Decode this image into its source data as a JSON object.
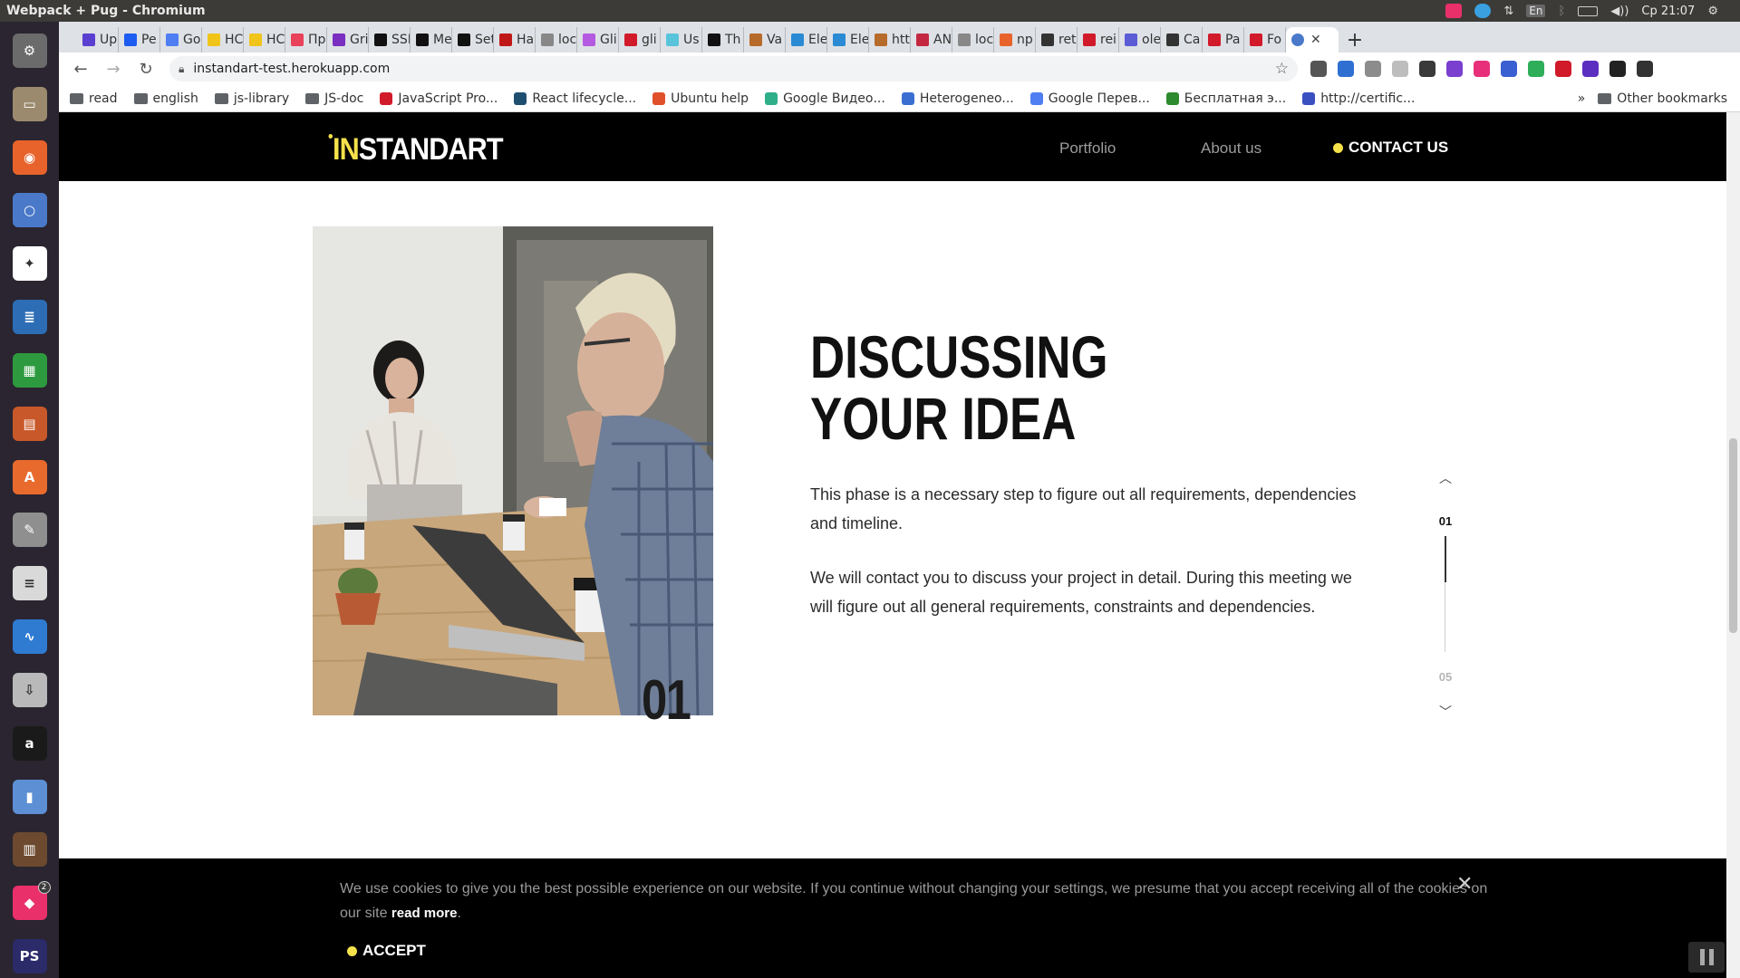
{
  "os": {
    "window_title": "Webpack + Pug - Chromium",
    "lang": "En",
    "clock": "Ср 21:07"
  },
  "launcher": {
    "items": [
      {
        "name": "settings-icon",
        "color": "#6b6b6b",
        "glyph": "⚙"
      },
      {
        "name": "files-icon",
        "color": "#9b8a6e",
        "glyph": "▭"
      },
      {
        "name": "firefox-icon",
        "color": "#e8632b",
        "glyph": "◉"
      },
      {
        "name": "chromium-icon",
        "color": "#4a79c9",
        "glyph": "○"
      },
      {
        "name": "slack-icon",
        "color": "#ffffff",
        "glyph": "✦"
      },
      {
        "name": "writer-icon",
        "color": "#2d6db5",
        "glyph": "≣"
      },
      {
        "name": "calc-icon",
        "color": "#2e9a3f",
        "glyph": "▦"
      },
      {
        "name": "impress-icon",
        "color": "#c8582a",
        "glyph": "▤"
      },
      {
        "name": "software-center-icon",
        "color": "#e86b2d",
        "glyph": "A"
      },
      {
        "name": "system-tools-icon",
        "color": "#8f8f8f",
        "glyph": "✎"
      },
      {
        "name": "text-editor-icon",
        "color": "#d9d9d9",
        "glyph": "≡"
      },
      {
        "name": "system-monitor-icon",
        "color": "#2f7bd1",
        "glyph": "∿"
      },
      {
        "name": "installer-icon",
        "color": "#b9b9b9",
        "glyph": "⇩"
      },
      {
        "name": "amazon-icon",
        "color": "#1a1a1a",
        "glyph": "a"
      },
      {
        "name": "thermometer-icon",
        "color": "#5d8fd4",
        "glyph": "▮"
      },
      {
        "name": "library-icon",
        "color": "#6d4a2f",
        "glyph": "▥"
      },
      {
        "name": "jetbrains-icon",
        "color": "#e9306b",
        "glyph": "◆",
        "badge": "2"
      },
      {
        "name": "phpstorm-icon",
        "color": "#2b2b6a",
        "glyph": "PS"
      }
    ]
  },
  "browser": {
    "tabs": [
      {
        "label": "Up",
        "color": "#5b3fd1"
      },
      {
        "label": "Pe",
        "color": "#1d5cf0"
      },
      {
        "label": "Go",
        "color": "#4f7ef2"
      },
      {
        "label": "HC",
        "color": "#f0c419"
      },
      {
        "label": "HC",
        "color": "#f0c419"
      },
      {
        "label": "Пр",
        "color": "#e8435a"
      },
      {
        "label": "Gri",
        "color": "#7a2fc0"
      },
      {
        "label": "SSI",
        "color": "#111111"
      },
      {
        "label": "Me",
        "color": "#111111"
      },
      {
        "label": "Set",
        "color": "#111111"
      },
      {
        "label": "Ha",
        "color": "#c01818"
      },
      {
        "label": "loc",
        "color": "#888888"
      },
      {
        "label": "Gli",
        "color": "#b45ae0"
      },
      {
        "label": "gli",
        "color": "#d11a2a"
      },
      {
        "label": "Us",
        "color": "#58c4dc"
      },
      {
        "label": "Th",
        "color": "#111111"
      },
      {
        "label": "Va",
        "color": "#b66b2a"
      },
      {
        "label": "Ele",
        "color": "#2a8ad4"
      },
      {
        "label": "Ele",
        "color": "#2a8ad4"
      },
      {
        "label": "htt",
        "color": "#b66b2a"
      },
      {
        "label": "AN",
        "color": "#c42840"
      },
      {
        "label": "loc",
        "color": "#888888"
      },
      {
        "label": "np",
        "color": "#e8632b"
      },
      {
        "label": "ret",
        "color": "#333333"
      },
      {
        "label": "rei",
        "color": "#d11a2a"
      },
      {
        "label": "ole",
        "color": "#5b5bd6"
      },
      {
        "label": "Ca",
        "color": "#333333"
      },
      {
        "label": "Pa",
        "color": "#d11a2a"
      },
      {
        "label": "Fo",
        "color": "#d11a2a"
      }
    ],
    "active_tab_color": "#4a79c9",
    "url": "instandart-test.herokuapp.com",
    "extensions": [
      "#555555",
      "#2f6fd1",
      "#8c8c8c",
      "#bdbdbd",
      "#3a3a3a",
      "#7b3fd0",
      "#e8307a",
      "#3a5fd1",
      "#2fae5a",
      "#d11a2a",
      "#5b2fc0",
      "#222222",
      "#333333"
    ],
    "bookmarks": [
      {
        "label": "read",
        "type": "folder"
      },
      {
        "label": "english",
        "type": "folder"
      },
      {
        "label": "js-library",
        "type": "folder"
      },
      {
        "label": "JS-doc",
        "type": "folder"
      },
      {
        "label": "JavaScript Pro...",
        "type": "site",
        "color": "#d11a2a"
      },
      {
        "label": "React lifecycle...",
        "type": "site",
        "color": "#1f4f6f"
      },
      {
        "label": "Ubuntu help",
        "type": "site",
        "color": "#e0502a"
      },
      {
        "label": "Google Видео...",
        "type": "site",
        "color": "#2fae8a"
      },
      {
        "label": "Heterogeneo...",
        "type": "site",
        "color": "#3a6fd1"
      },
      {
        "label": "Google Перев...",
        "type": "site",
        "color": "#4f7ef2"
      },
      {
        "label": "Бесплатная э...",
        "type": "site",
        "color": "#2e8a2e"
      },
      {
        "label": "http://certific...",
        "type": "site",
        "color": "#3a4fc0"
      }
    ],
    "bookmarks_overflow": "»",
    "other_bookmarks": "Other bookmarks"
  },
  "site": {
    "logo_accent": "IN",
    "logo_rest": "STANDART",
    "nav": {
      "portfolio": "Portfolio",
      "about": "About us",
      "contact": "CONTACT US"
    },
    "step": {
      "number": "01",
      "title_line1": "DISCUSSING",
      "title_line2": "YOUR IDEA",
      "paragraph1": "This phase is a necessary step to figure out all requirements, dependencies and timeline.",
      "paragraph2": "We will contact you to discuss your project in detail. During this meeting we will figure out all general requirements, constraints and dependencies."
    },
    "pager": {
      "current": "01",
      "total": "05",
      "progress": 0.4
    },
    "cookie": {
      "text": "We use cookies to give you the best possible experience on our website. If you continue without changing your settings, we presume that you accept receiving all of the cookies on our site",
      "read_more": "read more",
      "period": ".",
      "accept": "ACCEPT"
    },
    "colors": {
      "accent": "#f5e14a",
      "header_bg": "#000000",
      "nav_inactive": "#9c9c9c"
    }
  }
}
